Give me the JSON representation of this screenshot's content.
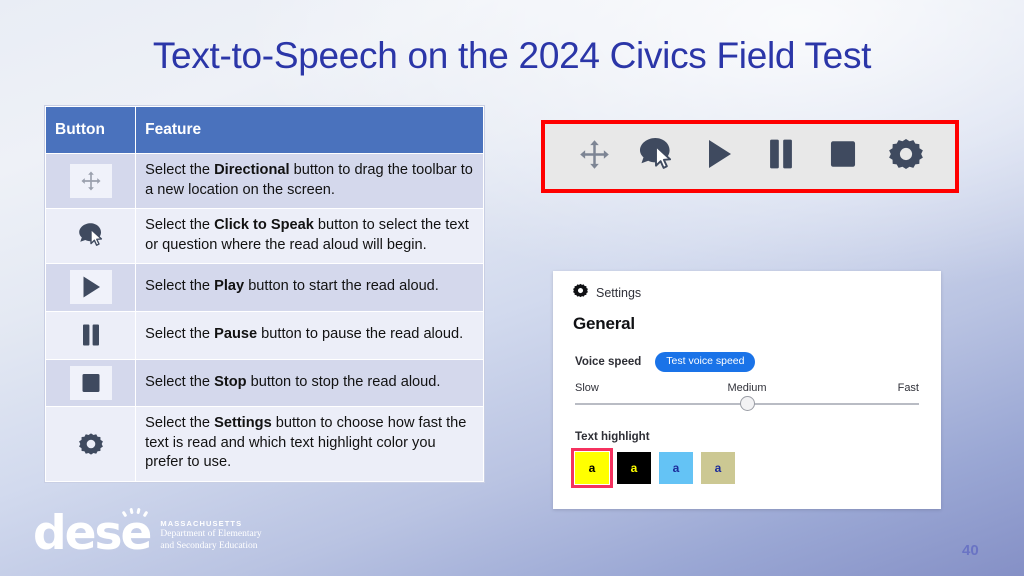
{
  "slide": {
    "title": "Text-to-Speech on the 2024 Civics Field Test",
    "page_number": "40",
    "title_color": "#2b36a8",
    "header_blue": "#4a72bd",
    "highlight_border": "#ff0000"
  },
  "table": {
    "headers": [
      "Button",
      "Feature"
    ],
    "rows": [
      {
        "icon": "directional-icon",
        "text_parts": [
          "Select the ",
          "Directional",
          " button to drag the toolbar to a new location on the screen."
        ]
      },
      {
        "icon": "click-to-speak-icon",
        "text_parts": [
          "Select the ",
          "Click to Speak",
          " button to select the text or question where the read aloud will begin."
        ]
      },
      {
        "icon": "play-icon",
        "text_parts": [
          "Select the ",
          "Play",
          " button to start the read aloud."
        ]
      },
      {
        "icon": "pause-icon",
        "text_parts": [
          "Select the ",
          "Pause",
          " button to pause the read aloud."
        ]
      },
      {
        "icon": "stop-icon",
        "text_parts": [
          "Select the ",
          "Stop",
          " button to stop the read aloud."
        ]
      },
      {
        "icon": "settings-gear-icon",
        "text_parts": [
          "Select the ",
          "Settings",
          " button to choose how fast the text is read and which text highlight color you prefer to use."
        ]
      }
    ]
  },
  "toolbar": {
    "buttons": [
      {
        "name": "directional-icon",
        "label": "Directional"
      },
      {
        "name": "click-to-speak-icon",
        "label": "Click to Speak"
      },
      {
        "name": "play-icon",
        "label": "Play"
      },
      {
        "name": "pause-icon",
        "label": "Pause"
      },
      {
        "name": "stop-icon",
        "label": "Stop"
      },
      {
        "name": "settings-gear-icon",
        "label": "Settings"
      }
    ],
    "icon_color": "#3f4a5f",
    "background": "#e8e8e8"
  },
  "settings_panel": {
    "header_label": "Settings",
    "section_title": "General",
    "voice_speed_label": "Voice speed",
    "test_button_label": "Test voice speed",
    "test_button_color": "#1a73e8",
    "slider": {
      "ticks": [
        "Slow",
        "Medium",
        "Fast"
      ],
      "value_percent": 50
    },
    "text_highlight_label": "Text highlight",
    "swatches": [
      {
        "name": "highlight-yellow",
        "bg": "#ffff00",
        "fg": "#000000",
        "glyph": "a",
        "selected": true
      },
      {
        "name": "highlight-black",
        "bg": "#000000",
        "fg": "#ffff00",
        "glyph": "a",
        "selected": false
      },
      {
        "name": "highlight-blue",
        "bg": "#64c3f5",
        "fg": "#1c2c9b",
        "glyph": "a",
        "selected": false
      },
      {
        "name": "highlight-khaki",
        "bg": "#ccc893",
        "fg": "#1c2c9b",
        "glyph": "a",
        "selected": false
      }
    ],
    "selected_swatch_border": "#f5315f"
  },
  "logo": {
    "wordmark": "dese",
    "line1": "MASSACHUSETTS",
    "line2": "Department of Elementary",
    "line3": "and Secondary Education"
  }
}
